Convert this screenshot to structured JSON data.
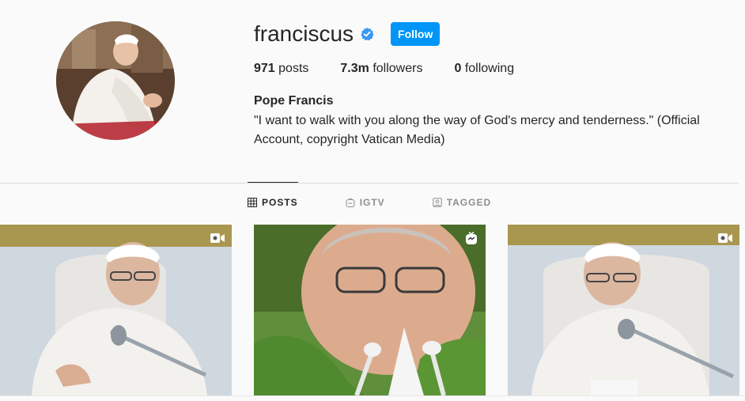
{
  "profile": {
    "username": "franciscus",
    "follow_label": "Follow",
    "full_name": "Pope Francis",
    "bio": "\"I want to walk with you along the way of God's mercy and tenderness.\" (Official Account, copyright Vatican Media)",
    "stats": {
      "posts_count": "971",
      "posts_label": "posts",
      "followers_count": "7.3m",
      "followers_label": "followers",
      "following_count": "0",
      "following_label": "following"
    }
  },
  "tabs": [
    {
      "label": "POSTS",
      "icon": "grid-icon",
      "active": true
    },
    {
      "label": "IGTV",
      "icon": "igtv-icon",
      "active": false
    },
    {
      "label": "TAGGED",
      "icon": "tagged-icon",
      "active": false
    }
  ],
  "posts": [
    {
      "type": "video",
      "badge_icon": "video-icon"
    },
    {
      "type": "igtv",
      "badge_icon": "igtv-icon"
    },
    {
      "type": "video",
      "badge_icon": "video-icon"
    }
  ],
  "colors": {
    "accent": "#0095f6",
    "verified": "#3897f0",
    "background": "#fafafa",
    "text": "#262626",
    "muted": "#8e8e8e"
  }
}
